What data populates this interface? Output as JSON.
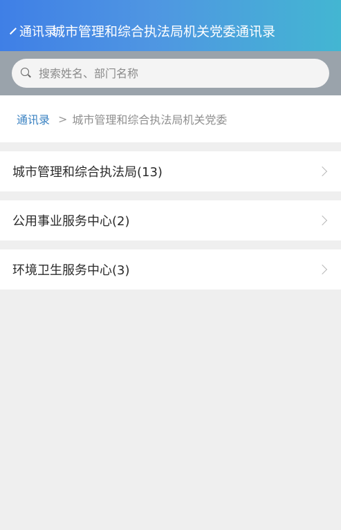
{
  "header": {
    "back_label": "通讯录",
    "title": "城市管理和综合执法局机关党委通讯录"
  },
  "search": {
    "placeholder": "搜索姓名、部门名称"
  },
  "breadcrumb": {
    "root": "通讯录",
    "separator": ">",
    "current": "城市管理和综合执法局机关党委"
  },
  "departments": [
    {
      "label": "城市管理和综合执法局(13)"
    },
    {
      "label": "公用事业服务中心(2)"
    },
    {
      "label": "环境卫生服务中心(3)"
    }
  ],
  "colors": {
    "header_gradient_start": "#3f7fe6",
    "header_gradient_end": "#43b6d2",
    "breadcrumb_link": "#3a82c2",
    "background": "#efefef"
  },
  "icons": {
    "back": "chevron-left-icon",
    "search": "search-icon",
    "row_arrow": "chevron-right-icon"
  }
}
